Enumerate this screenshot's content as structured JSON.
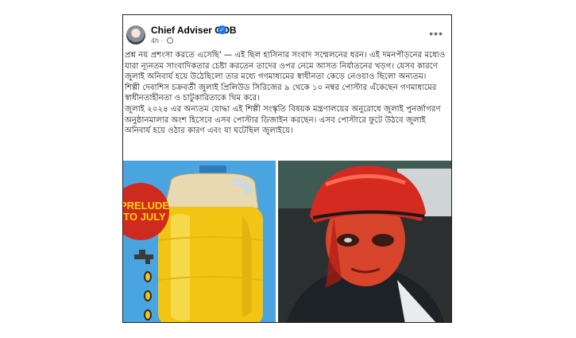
{
  "post": {
    "author": "Chief Adviser GOB",
    "time": "4h",
    "separator": "·",
    "more_label": "•••",
    "verified_mark": "✓",
    "paragraphs": [
      "প্রশ্ন নয় প্রশংসা করতে এসেছি' — এই ছিল হাসিনার সংবাদ সম্মেলনের ধরন। এই দমনপীড়নের মধ্যেও যারা ন্যূনতম সাংবাদিকতার চেষ্টা করতেন তাদের ওপর নেমে আসত নির্যাতনের খড়গ। যেসব কারণে জুলাই অনিবার্য হয়ে উঠেছিলো তার মধ্যে গণমাধ্যমের স্বাধীনতা কেড়ে নেওয়াও ছিলো অন্যতম।",
      "শিল্পী দেবাশিস চক্রবর্তী জুলাই প্রিলিউড সিরিজের ৯ থেকে ১০ নম্বর পোস্টার এঁকেছেন গণমাধ্যমের স্বাধীনতাহীনতা ও চাটুকারিতাকে থিম করে।",
      "জুলাই ২০২৪ এর অন্যতম যোদ্ধা এই শিল্পী সংস্কৃতি বিষয়ক মন্ত্রণালয়ের অনুরোধে জুলাই পুনর্জাগরণ অনুষ্ঠানমালার অংশ হিসেবে এসব পোস্টার ডিজাইন করছেন। এসব পোস্টারে ফুটে উঠবে জুলাই অনিবার্য হয়ে ওঠার কারণ এবং যা ঘটেছিল জুলাইয়ে।"
    ]
  },
  "poster_left": {
    "badge_text": "PRELUDE TO JULY",
    "bg_color": "#4aa4e0",
    "badge_color": "#cf2a1f",
    "badge_text_color": "#ffd400",
    "oil_color": "#f2c515"
  },
  "poster_right": {
    "helmet_color": "#d42a20",
    "bg_color": "#2b2f2f"
  }
}
